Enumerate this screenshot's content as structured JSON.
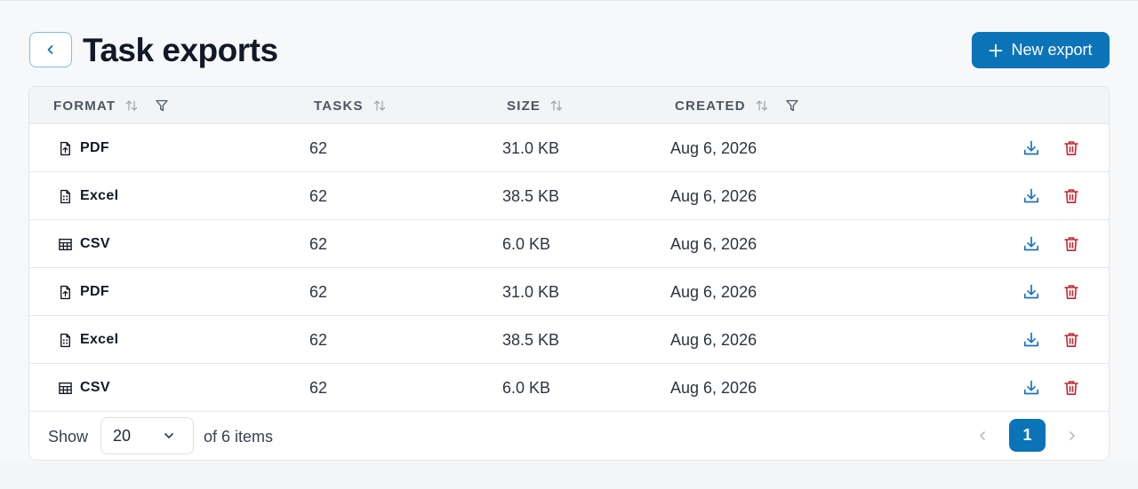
{
  "header": {
    "title": "Task exports",
    "back_icon": "chevron-left-icon",
    "new_export_label": "New export",
    "new_export_icon": "plus-icon"
  },
  "colors": {
    "primary": "#0b73b8",
    "danger": "#c0262d",
    "download": "#1a73c0"
  },
  "table": {
    "columns": {
      "format": "FORMAT",
      "tasks": "TASKS",
      "size": "SIZE",
      "created": "CREATED"
    },
    "rows": [
      {
        "format": "PDF",
        "format_icon": "file-pdf-icon",
        "tasks": "62",
        "size": "31.0 KB",
        "created": "Aug 6, 2026"
      },
      {
        "format": "Excel",
        "format_icon": "file-spreadsheet-icon",
        "tasks": "62",
        "size": "38.5 KB",
        "created": "Aug 6, 2026"
      },
      {
        "format": "CSV",
        "format_icon": "table-icon",
        "tasks": "62",
        "size": "6.0 KB",
        "created": "Aug 6, 2026"
      },
      {
        "format": "PDF",
        "format_icon": "file-pdf-icon",
        "tasks": "62",
        "size": "31.0 KB",
        "created": "Aug 6, 2026"
      },
      {
        "format": "Excel",
        "format_icon": "file-spreadsheet-icon",
        "tasks": "62",
        "size": "38.5 KB",
        "created": "Aug 6, 2026"
      },
      {
        "format": "CSV",
        "format_icon": "table-icon",
        "tasks": "62",
        "size": "6.0 KB",
        "created": "Aug 6, 2026"
      }
    ]
  },
  "footer": {
    "show_label": "Show",
    "page_size": "20",
    "items_text": "of 6 items",
    "current_page": "1"
  }
}
